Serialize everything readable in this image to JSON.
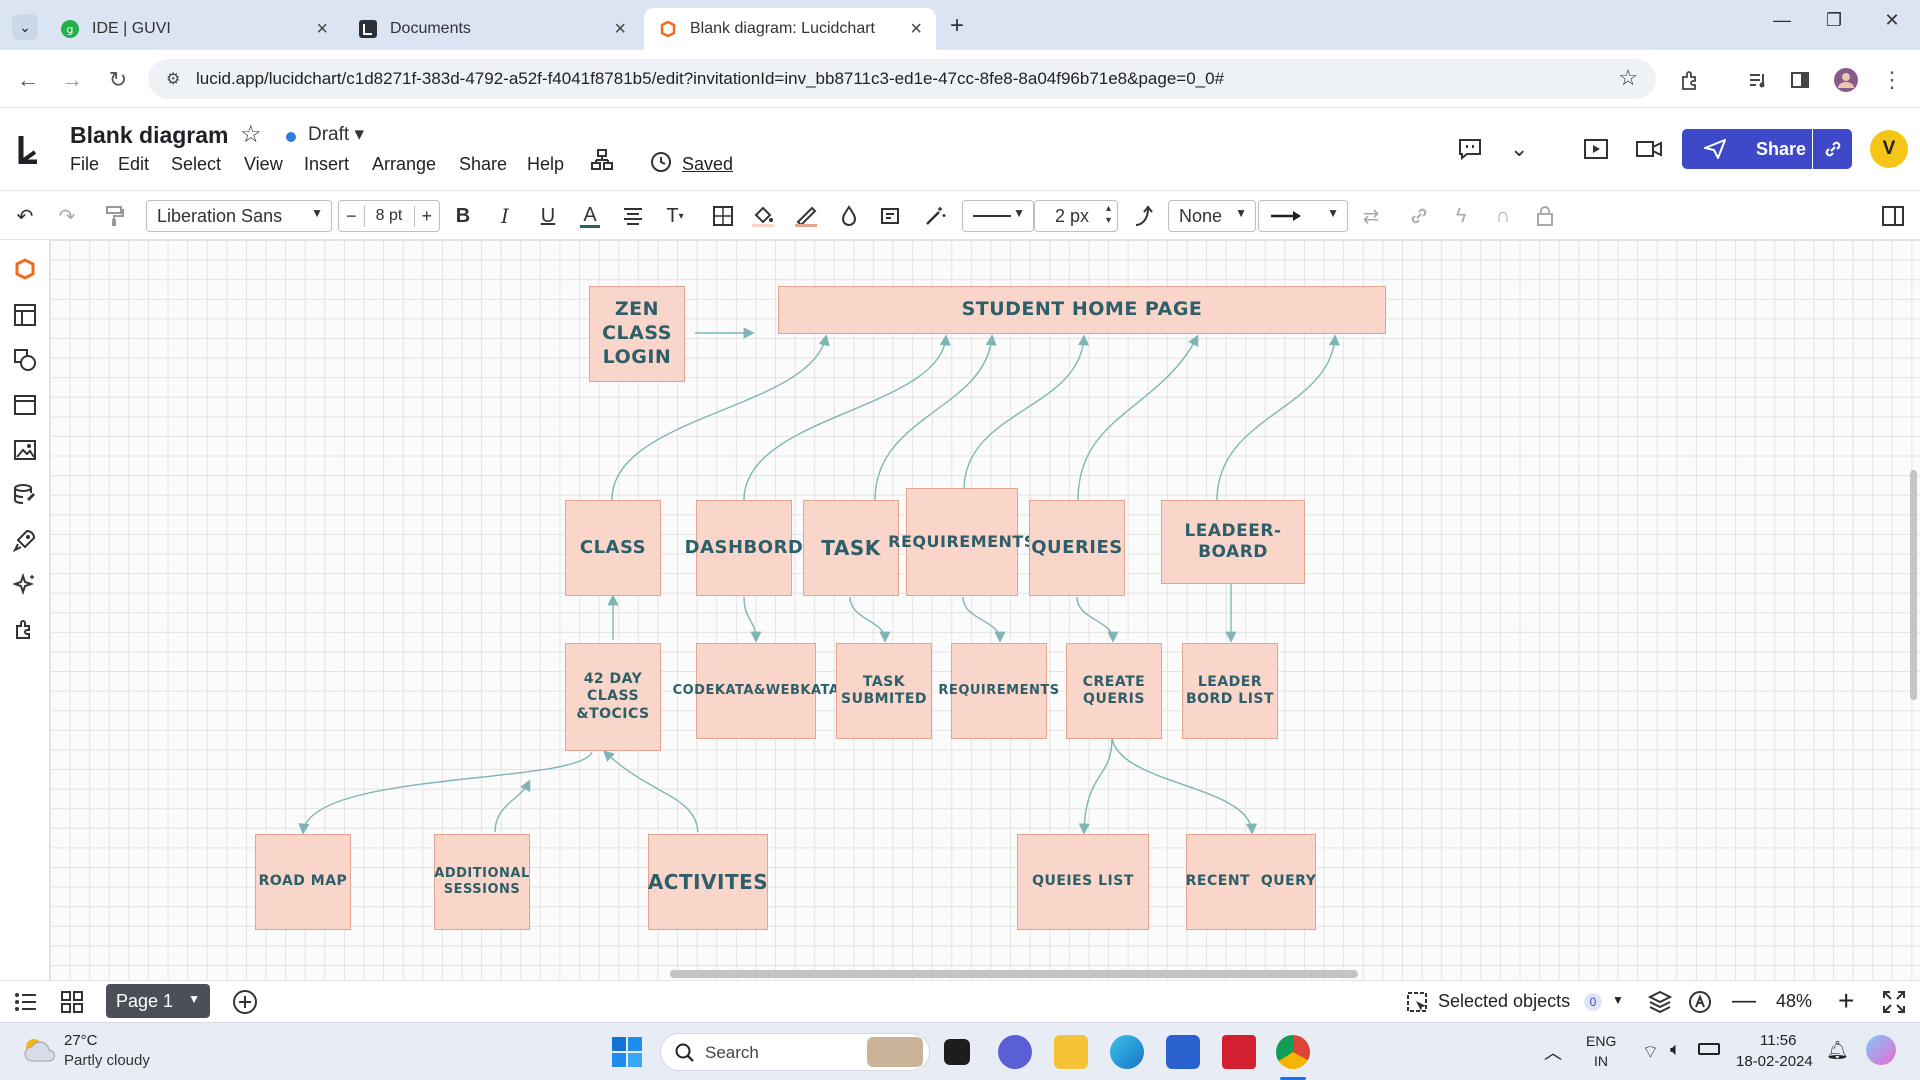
{
  "browser": {
    "tabs": [
      {
        "label": "IDE | GUVI",
        "icon": "guvi-icon"
      },
      {
        "label": "Documents",
        "icon": "lucid-doc-icon"
      },
      {
        "label": "Blank diagram: Lucidchart",
        "icon": "lucidchart-icon"
      }
    ],
    "url": "lucid.app/lucidchart/c1d8271f-383d-4792-a52f-f4041f8781b5/edit?invitationId=inv_bb8711c3-ed1e-47cc-8fe8-8a04f96b71e8&page=0_0#"
  },
  "app": {
    "title": "Blank diagram",
    "status": "Draft",
    "saved": "Saved",
    "menu": [
      "File",
      "Edit",
      "Select",
      "View",
      "Insert",
      "Arrange",
      "Share",
      "Help"
    ],
    "share_label": "Share",
    "avatar_initial": "V"
  },
  "toolbar": {
    "font": "Liberation Sans",
    "font_size": "8 pt",
    "line_width": "2 px",
    "endpoint": "None"
  },
  "diagram": {
    "top": {
      "login": "ZEN CLASS LOGIN",
      "home": "STUDENT HOME PAGE"
    },
    "level2": [
      "CLASS",
      "DASHBORD",
      "TASK",
      "REQUIREMENTS",
      "QUERIES",
      "LEADEER-BOARD"
    ],
    "level3": [
      "42 DAY CLASS &TOCICS",
      "CODEKATA&WEBKATA",
      "TASK SUBMITED",
      "REQUIREMENTS",
      "CREATE QUERIS",
      "LEADER BORD LIST"
    ],
    "level4": [
      "ROAD MAP",
      "ADDITIONAL SESSIONS",
      "ACTIVITES",
      "QUEIES LIST",
      "RECENT  QUERY"
    ]
  },
  "bottom": {
    "page_label": "Page 1",
    "selected_label": "Selected objects",
    "selected_count": "0",
    "zoom": "48%"
  },
  "taskbar": {
    "temp": "27°C",
    "weather": "Partly cloudy",
    "search": "Search",
    "lang1": "ENG",
    "lang2": "IN",
    "time": "11:56",
    "date": "18-02-2024"
  },
  "colors": {
    "accent": "#3d49c8",
    "shape_fill": "#f9d6c9",
    "shape_text": "#2d5f6a",
    "connector": "#7fb5b5"
  }
}
